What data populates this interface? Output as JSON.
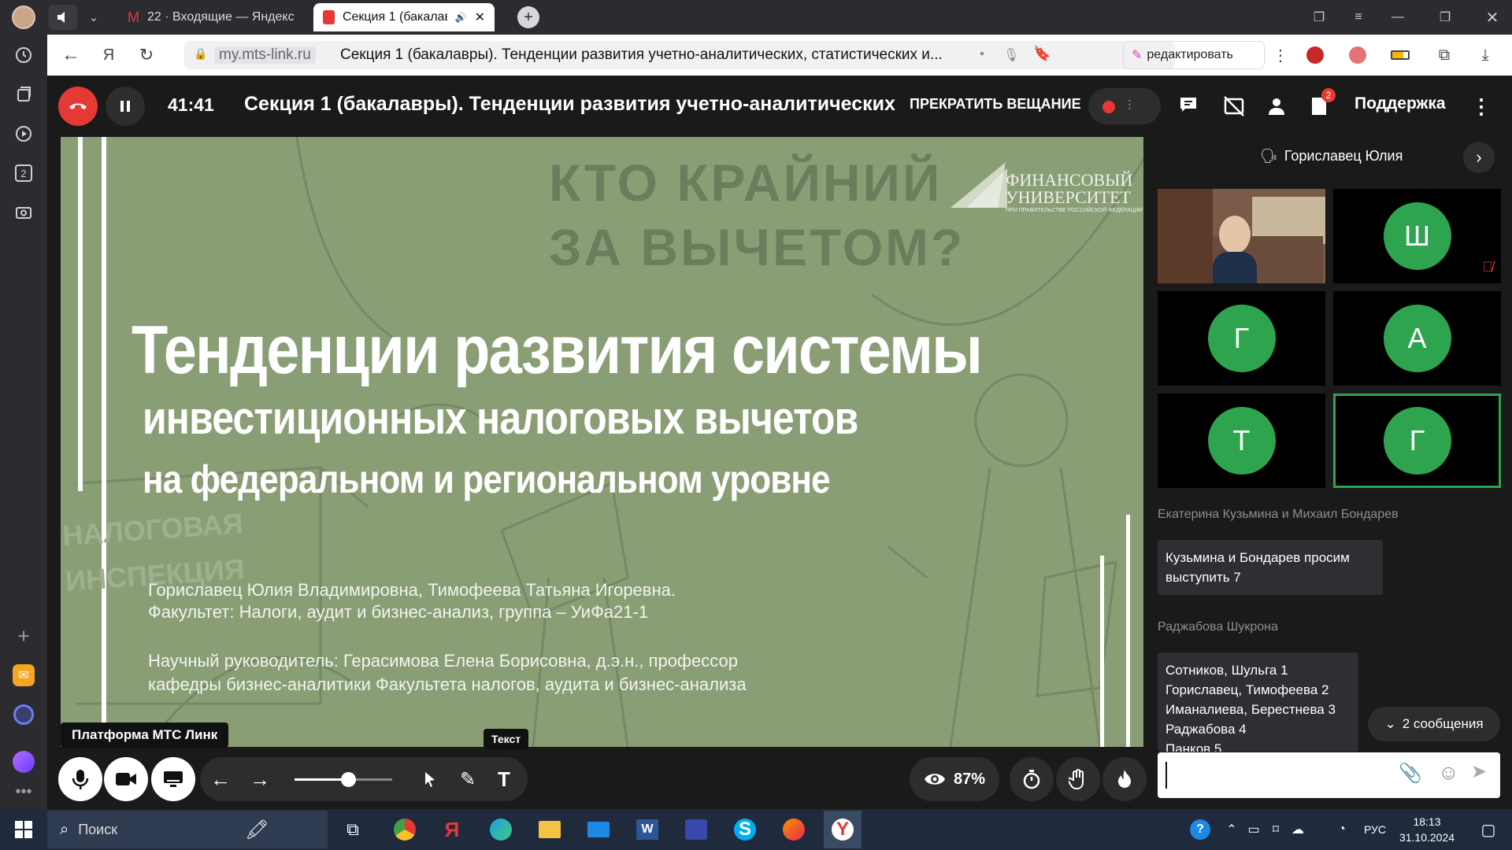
{
  "browser": {
    "tabs": [
      {
        "label": "22 · Входящие — Яндекс П",
        "icon": "mail-icon"
      },
      {
        "label": "Секция 1 (бакалавр",
        "icon": "mts-link-icon",
        "active": true
      }
    ],
    "url_domain": "my.mts-link.ru",
    "page_title": "Секция 1 (бакалавры). Тенденции развития учетно-аналитических, статистических и...",
    "edit_label": "редактировать"
  },
  "meeting": {
    "timer": "41:41",
    "title": "Секция 1 (бакалавры). Тенденции развития учетно-аналитических",
    "stop_broadcast": "ПРЕКРАТИТЬ ВЕЩАНИЕ",
    "files_badge": "2",
    "support_label": "Поддержка"
  },
  "slide": {
    "bg_caption_1": "КТО КРАЙНИЙ",
    "bg_caption_2": "ЗА ВЫЧЕТОМ?",
    "logo_line1": "ФИНАНСОВЫЙ",
    "logo_line2": "УНИВЕРСИТЕТ",
    "logo_sub": "ПРИ ПРАВИТЕЛЬСТВЕ РОССИЙСКОЙ ФЕДЕРАЦИИ",
    "title_1": "Тенденции развития системы",
    "title_2": "инвестиционных налоговых вычетов",
    "title_3": "на федеральном и региональном уровне",
    "authors_1": "Гориславец Юлия Владимировна, Тимофеева Татьяна Игоревна.",
    "authors_2": "Факультет: Налоги, аудит и бизнес-анализ, группа – УиФа21-1",
    "advisor_1": "Научный руководитель: Герасимова Елена Борисовна, д.э.н., профессор",
    "advisor_2": "кафедры бизнес-аналитики Факультета налогов, аудита и бизнес-анализа",
    "sign_1": "НАЛОГОВАЯ",
    "sign_2": "ИНСПЕКЦИЯ"
  },
  "bottom": {
    "platform_label": "Платформа МТС Линк",
    "tooltip": "Текст",
    "zoom_value": 0.55,
    "view_percent": "87%"
  },
  "panel": {
    "speaker": "Гориславец Юлия",
    "tiles": [
      {
        "type": "video"
      },
      {
        "letter": "Ш",
        "muted": true
      },
      {
        "letter": "Г"
      },
      {
        "letter": "А"
      },
      {
        "letter": "Т"
      },
      {
        "letter": "Г",
        "active": true
      }
    ],
    "chat": [
      {
        "author": "Екатерина Кузьмина и Михаил Бондарев",
        "text": "Кузьмина и Бондарев просим выступить 7"
      },
      {
        "author": "Раджабова Шукрона",
        "lines": [
          "Сотников, Шульга 1",
          "Гориславец, Тимофеева 2",
          "Иманалиева, Берестнева 3",
          "Раджабова 4",
          "Панков 5"
        ]
      }
    ],
    "new_messages": "2 сообщения",
    "input_placeholder": ""
  },
  "taskbar": {
    "search_label": "Поиск",
    "lang": "РУС",
    "time": "18:13",
    "date": "31.10.2024"
  },
  "colors": {
    "accent_green": "#2ea44f",
    "end_call_red": "#e53935",
    "slide_bg": "#8a9e76"
  }
}
